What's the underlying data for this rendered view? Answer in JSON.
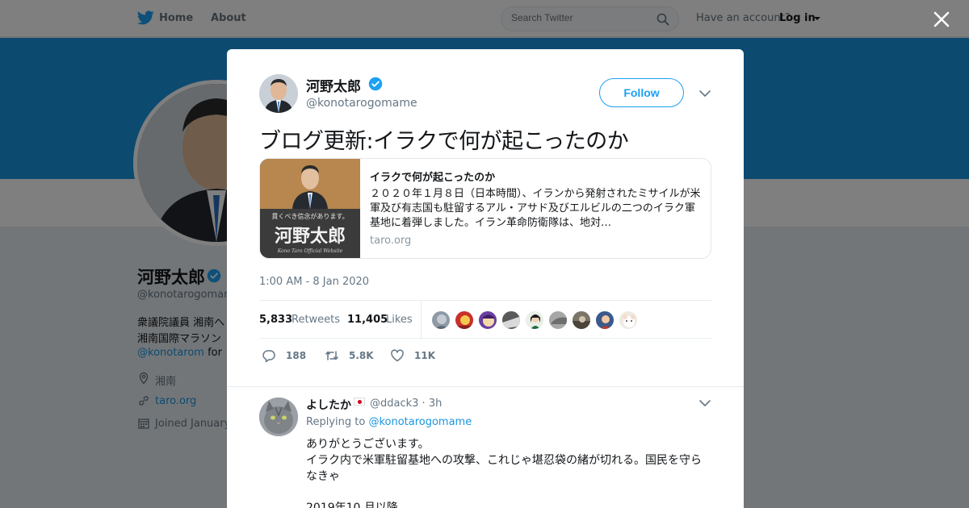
{
  "colors": {
    "brand": "#1da1f2",
    "banner": "#1b95e0",
    "text": "#14171a",
    "muted": "#657786"
  },
  "topnav": {
    "logo_icon": "twitter-bird-icon",
    "home": "Home",
    "about": "About",
    "search_placeholder": "Search Twitter",
    "account_prompt": "Have an account?",
    "login": "Log in"
  },
  "profile": {
    "name": "河野太郎",
    "handle": "@konotarogomam",
    "bio_line1": "衆議院議員 湘南へ",
    "bio_line2": "湘南国際マラソン",
    "bio_link": "@konotarom",
    "bio_link_suffix": "for",
    "location": "湘南",
    "website": "taro.org",
    "joined": "Joined January"
  },
  "tweet": {
    "author_name": "河野太郎",
    "author_handle": "@konotarogomame",
    "follow_label": "Follow",
    "text": "ブログ更新:イラクで何が起こったのか",
    "card": {
      "image_tagline": "貫くべき信念があります。",
      "image_name": "河野太郎",
      "image_footer": "Kono Taro Official Website",
      "title": "イラクで何が起こったのか",
      "description": "２０２０年１月８日（日本時間）、イランから発射されたミサイルが米軍及び有志国も駐留するアル・アサド及びエルビルの二つのイラク軍基地に着弾しました。イラン革命防衛隊は、地対…",
      "domain": "taro.org"
    },
    "timestamp": "1:00 AM - 8 Jan 2020",
    "retweets_count": "5,833",
    "retweets_label": "Retweets",
    "likes_count": "11,405",
    "likes_label": "Likes",
    "actions": {
      "replies": "188",
      "retweets": "5.8K",
      "likes": "11K"
    }
  },
  "reply": {
    "name": "よしたか",
    "handle": "@ddack3 · 3h",
    "replying_prefix": "Replying to",
    "replying_to": "@konotarogomame",
    "line1": "ありがとうございます。",
    "line2": "イラク内で米軍駐留基地への攻撃、これじゃ堪忍袋の緒が切れる。国民を守ら",
    "line3": "なきゃ",
    "line4": "2019年10 月以降"
  }
}
